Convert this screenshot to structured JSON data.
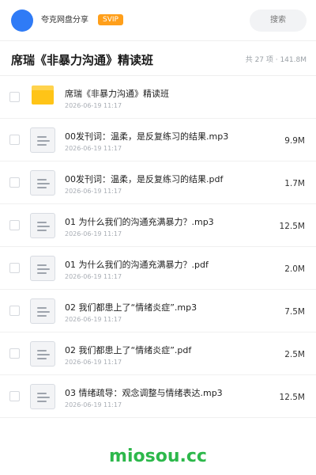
{
  "header": {
    "brand": "夸克网盘分享",
    "badge": "SVIP",
    "search_placeholder": "搜索"
  },
  "folder": {
    "title": "席瑞《非暴力沟通》精读班",
    "summary": "共 27 项 · 141.8M"
  },
  "items": [
    {
      "type": "folder",
      "name": "席瑞《非暴力沟通》精读班",
      "date": "2026-06-19 11:17",
      "size": ""
    },
    {
      "type": "file",
      "name": "00发刊词：温柔，是反复练习的结果.mp3",
      "date": "2026-06-19 11:17",
      "size": "9.9M"
    },
    {
      "type": "file",
      "name": "00发刊词：温柔，是反复练习的结果.pdf",
      "date": "2026-06-19 11:17",
      "size": "1.7M"
    },
    {
      "type": "file",
      "name": "01 为什么我们的沟通充满暴力？.mp3",
      "date": "2026-06-19 11:17",
      "size": "12.5M"
    },
    {
      "type": "file",
      "name": "01 为什么我们的沟通充满暴力？.pdf",
      "date": "2026-06-19 11:17",
      "size": "2.0M"
    },
    {
      "type": "file",
      "name": "02 我们都患上了“情绪炎症”.mp3",
      "date": "2026-06-19 11:17",
      "size": "7.5M"
    },
    {
      "type": "file",
      "name": "02 我们都患上了“情绪炎症”.pdf",
      "date": "2026-06-19 11:17",
      "size": "2.5M"
    },
    {
      "type": "file",
      "name": "03 情绪疏导：观念调整与情绪表达.mp3",
      "date": "2026-06-19 11:17",
      "size": "12.5M"
    }
  ],
  "watermark": "miosou.cc",
  "colors": {
    "avatar": "#2f7bf6",
    "badge": "#ff9f1a",
    "folder": "#ffc417",
    "watermark": "#2db84b"
  }
}
